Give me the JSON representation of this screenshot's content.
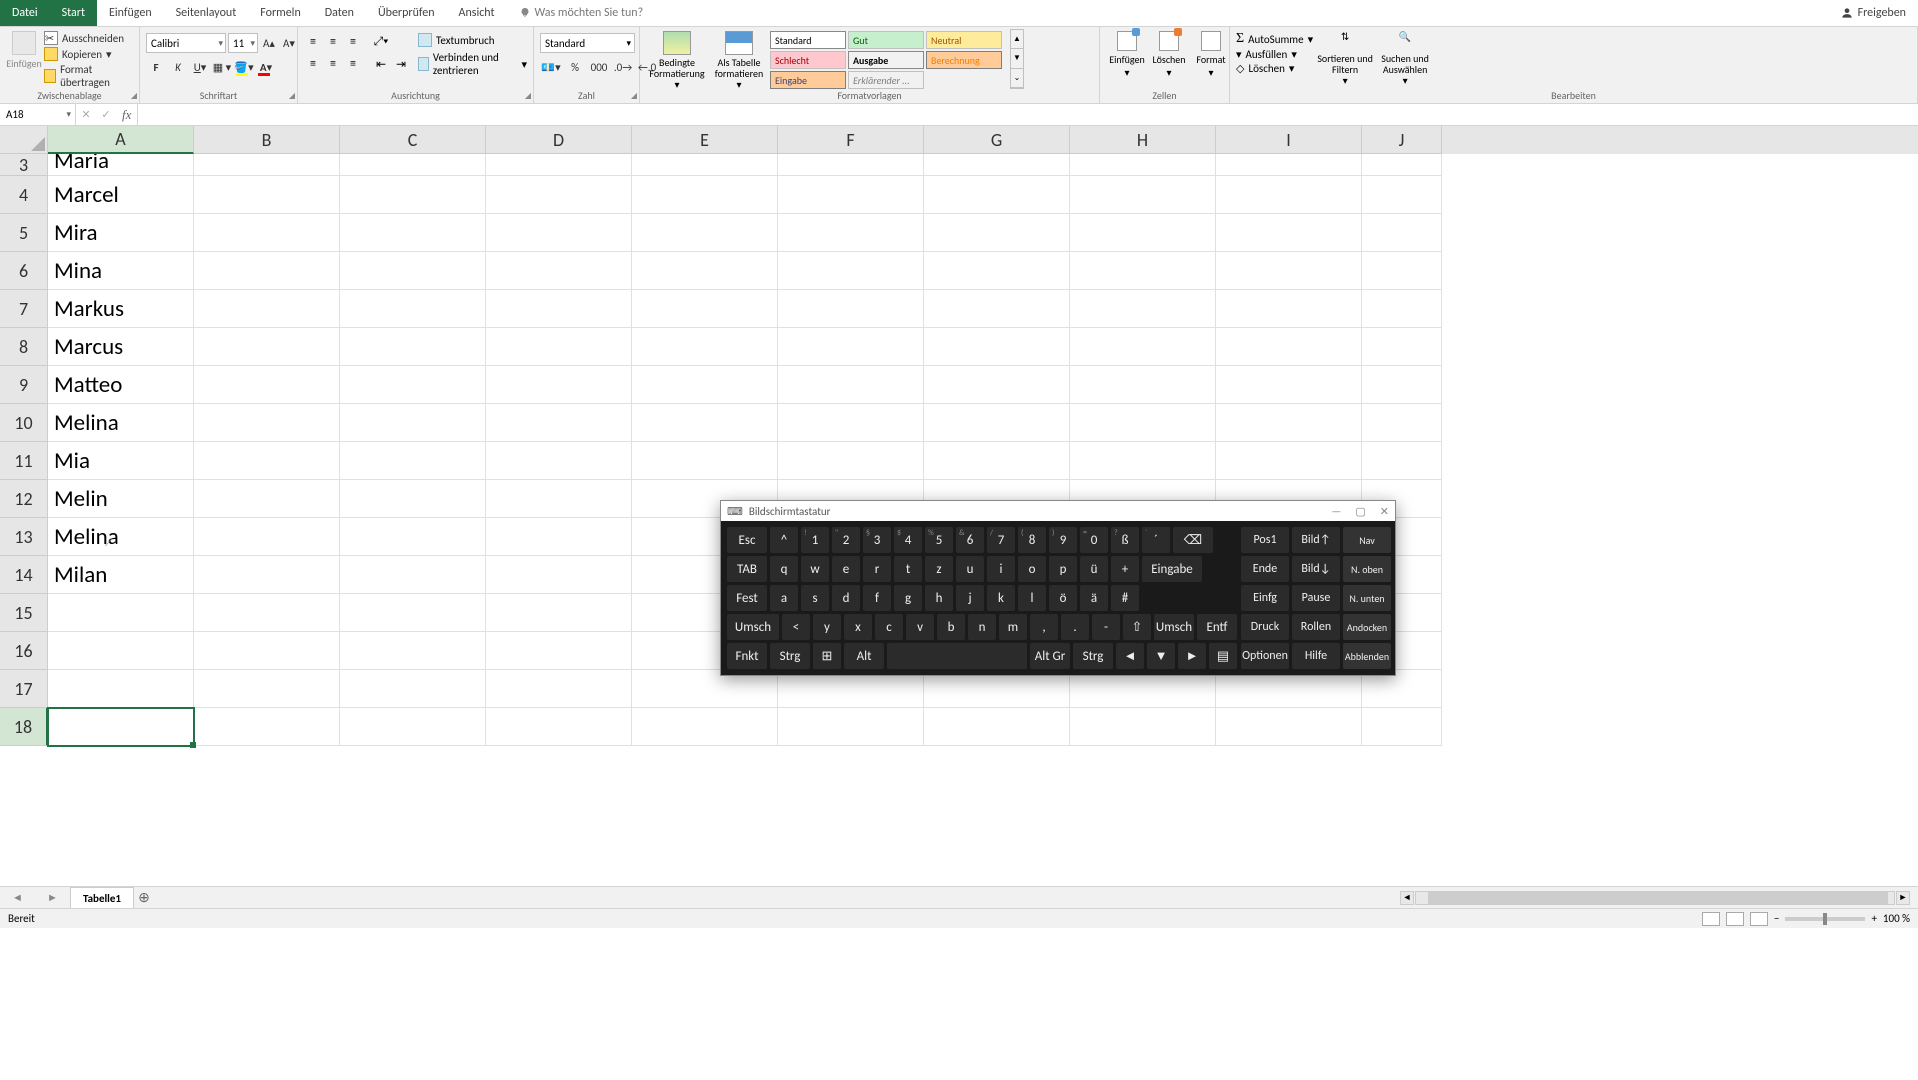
{
  "tabs": {
    "file": "Datei",
    "start": "Start",
    "einfuegen": "Einfügen",
    "seitenlayout": "Seitenlayout",
    "formeln": "Formeln",
    "daten": "Daten",
    "ueberpruefen": "Überprüfen",
    "ansicht": "Ansicht",
    "search": "Was möchten Sie tun?",
    "share": "Freigeben"
  },
  "ribbon": {
    "clipboard": {
      "label": "Zwischenablage",
      "paste": "Einfügen",
      "cut": "Ausschneiden",
      "copy": "Kopieren",
      "format": "Format übertragen"
    },
    "font": {
      "label": "Schriftart",
      "name": "Calibri",
      "size": "11"
    },
    "align": {
      "label": "Ausrichtung",
      "wrap": "Textumbruch",
      "merge": "Verbinden und zentrieren"
    },
    "number": {
      "label": "Zahl",
      "format": "Standard"
    },
    "styles": {
      "label": "Formatvorlagen",
      "cond": "Bedingte Formatierung",
      "table": "Als Tabelle formatieren",
      "gallery": [
        "Standard",
        "Gut",
        "Neutral",
        "Schlecht",
        "Ausgabe",
        "Berechnung",
        "Eingabe",
        "Erklärender ..."
      ]
    },
    "cells": {
      "label": "Zellen",
      "insert": "Einfügen",
      "delete": "Löschen",
      "format": "Format"
    },
    "edit": {
      "label": "Bearbeiten",
      "sum": "AutoSumme",
      "fill": "Ausfüllen",
      "clear": "Löschen",
      "sort": "Sortieren und Filtern",
      "find": "Suchen und Auswählen"
    }
  },
  "namebox": "A18",
  "columns": [
    "A",
    "B",
    "C",
    "D",
    "E",
    "F",
    "G",
    "H",
    "I",
    "J"
  ],
  "rows": [
    {
      "n": 3,
      "a": "Maria"
    },
    {
      "n": 4,
      "a": "Marcel"
    },
    {
      "n": 5,
      "a": "Mira"
    },
    {
      "n": 6,
      "a": "Mina"
    },
    {
      "n": 7,
      "a": "Markus"
    },
    {
      "n": 8,
      "a": "Marcus"
    },
    {
      "n": 9,
      "a": "Matteo"
    },
    {
      "n": 10,
      "a": "Melina"
    },
    {
      "n": 11,
      "a": "Mia"
    },
    {
      "n": 12,
      "a": "Melin"
    },
    {
      "n": 13,
      "a": "Melina"
    },
    {
      "n": 14,
      "a": "Milan"
    },
    {
      "n": 15,
      "a": ""
    },
    {
      "n": 16,
      "a": ""
    },
    {
      "n": 17,
      "a": ""
    },
    {
      "n": 18,
      "a": ""
    }
  ],
  "active_row": 18,
  "sheet": {
    "name": "Tabelle1"
  },
  "status": {
    "ready": "Bereit",
    "zoom": "100 %"
  },
  "osk": {
    "title": "Bildschirmtastatur",
    "row1": [
      "Esc",
      "^",
      "1",
      "2",
      "3",
      "4",
      "5",
      "6",
      "7",
      "8",
      "9",
      "0",
      "ß",
      "´",
      "⌫"
    ],
    "row1_sup": [
      "",
      "",
      "!",
      "\"",
      "§",
      "$",
      "%",
      "&",
      "/",
      "(",
      ")",
      "=",
      "?",
      "`",
      ""
    ],
    "row2": [
      "TAB",
      "q",
      "w",
      "e",
      "r",
      "t",
      "z",
      "u",
      "i",
      "o",
      "p",
      "ü",
      "+",
      "Eingabe"
    ],
    "row3": [
      "Fest",
      "a",
      "s",
      "d",
      "f",
      "g",
      "h",
      "j",
      "k",
      "l",
      "ö",
      "ä",
      "#"
    ],
    "row4": [
      "Umsch",
      "<",
      "y",
      "x",
      "c",
      "v",
      "b",
      "n",
      "m",
      ",",
      ".",
      "-",
      "⇧",
      "Umsch",
      "Entf"
    ],
    "row5": [
      "Fnkt",
      "Strg",
      "⊞",
      "Alt",
      " ",
      "Alt Gr",
      "Strg",
      "◄",
      "▼",
      "►",
      "▤"
    ],
    "side": [
      [
        "Pos1",
        "Bild↑",
        "Nav"
      ],
      [
        "Ende",
        "Bild↓",
        "N. oben"
      ],
      [
        "Einfg",
        "Pause",
        "N. unten"
      ],
      [
        "Druck",
        "Rollen",
        "Andocken"
      ],
      [
        "Optionen",
        "Hilfe",
        "Abblenden"
      ]
    ]
  }
}
